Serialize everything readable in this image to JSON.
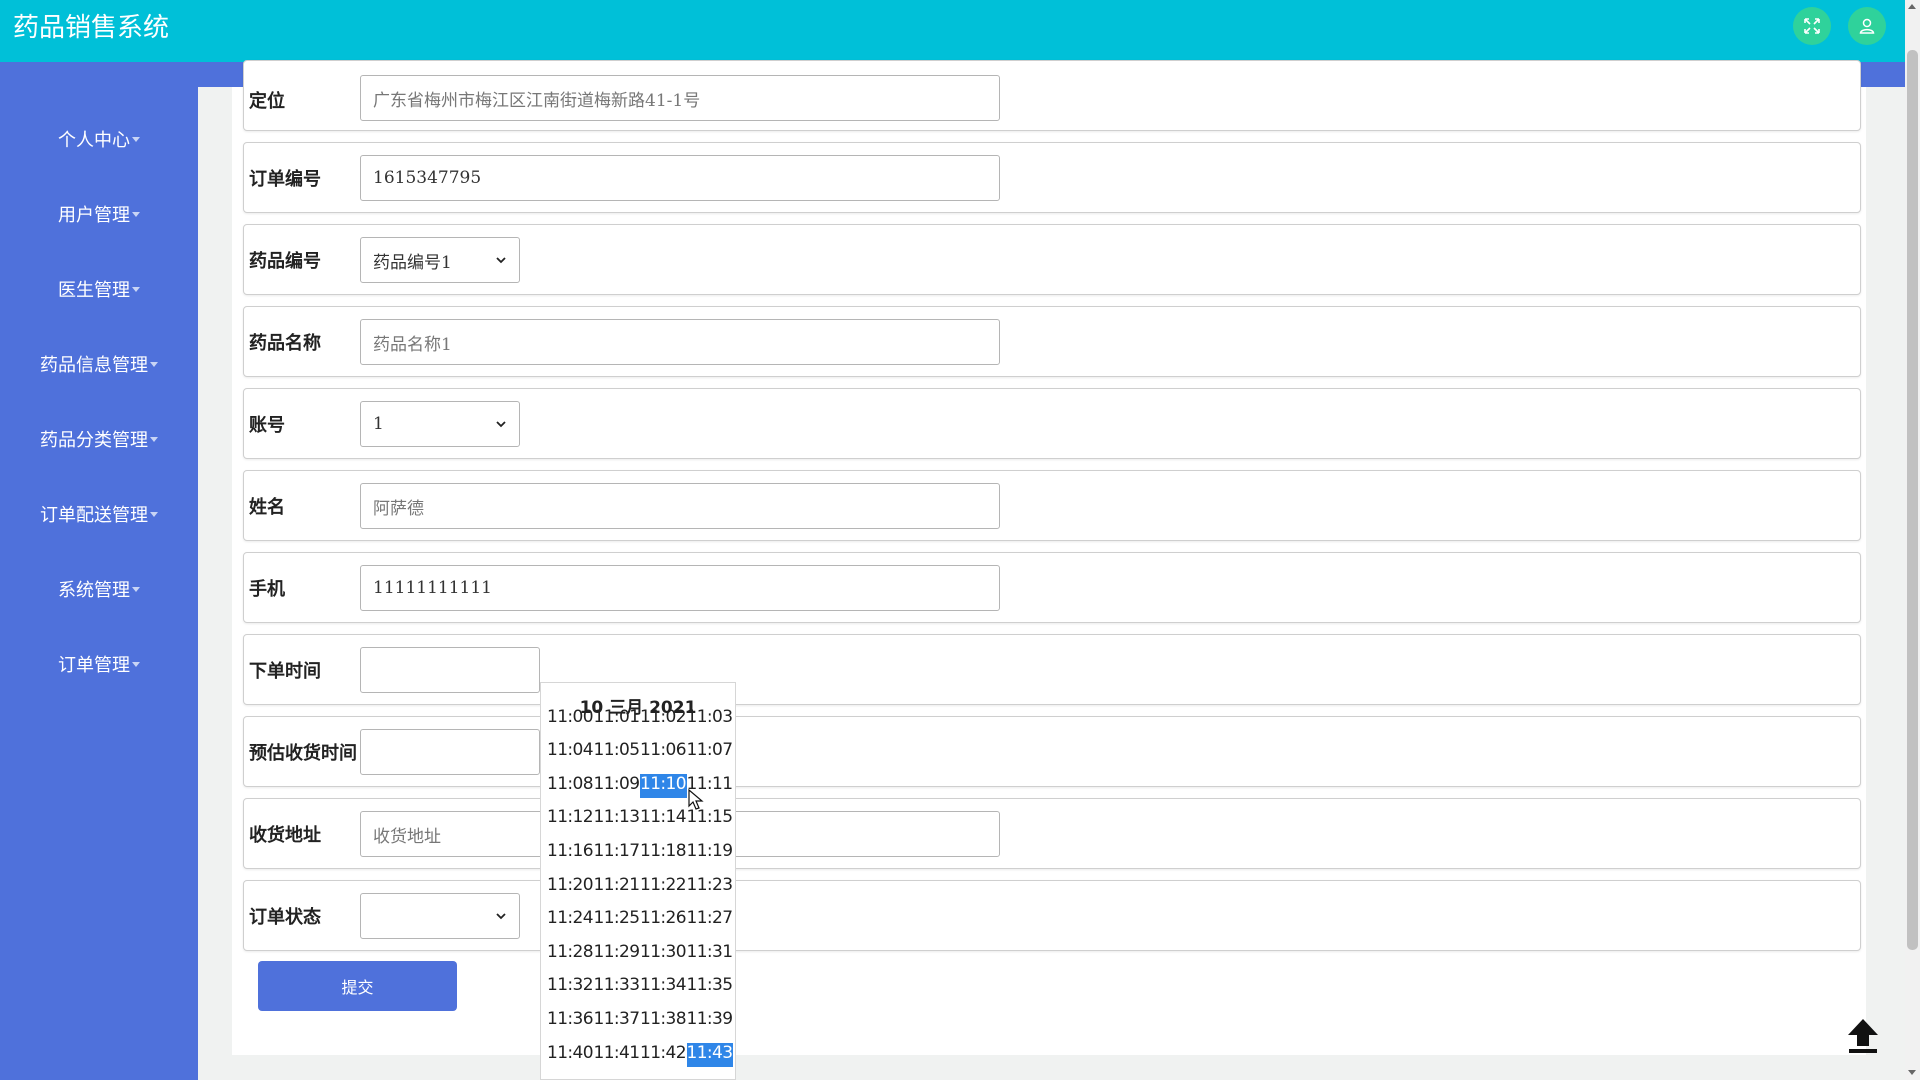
{
  "app": {
    "title": "药品销售系统"
  },
  "header_icons": [
    "fullscreen-icon",
    "user-icon"
  ],
  "sidebar": {
    "items": [
      {
        "label": "个人中心"
      },
      {
        "label": "用户管理"
      },
      {
        "label": "医生管理"
      },
      {
        "label": "药品信息管理"
      },
      {
        "label": "药品分类管理"
      },
      {
        "label": "订单配送管理"
      },
      {
        "label": "系统管理"
      },
      {
        "label": "订单管理"
      }
    ]
  },
  "form": {
    "location": {
      "label": "定位",
      "value": "广东省梅州市梅江区江南街道梅新路41-1号"
    },
    "order_no": {
      "label": "订单编号",
      "value": "1615347795"
    },
    "drug_no": {
      "label": "药品编号",
      "value": "药品编号1"
    },
    "drug_name": {
      "label": "药品名称",
      "value": "药品名称1"
    },
    "account": {
      "label": "账号",
      "value": "1"
    },
    "name": {
      "label": "姓名",
      "value": "阿萨德"
    },
    "phone": {
      "label": "手机",
      "value": "11111111111"
    },
    "order_time": {
      "label": "下单时间",
      "value": ""
    },
    "eta": {
      "label": "预估收货时间",
      "value": ""
    },
    "address": {
      "label": "收货地址",
      "placeholder": "收货地址"
    },
    "status": {
      "label": "订单状态",
      "value": ""
    },
    "submit_label": "提交"
  },
  "datetime_picker": {
    "title": "10 三月 2021",
    "rows": [
      [
        "11:00",
        "11:01",
        "11:02",
        "11:03"
      ],
      [
        "11:04",
        "11:05",
        "11:06",
        "11:07"
      ],
      [
        "11:08",
        "11:09",
        "11:10",
        "11:11"
      ],
      [
        "11:12",
        "11:13",
        "11:14",
        "11:15"
      ],
      [
        "11:16",
        "11:17",
        "11:18",
        "11:19"
      ],
      [
        "11:20",
        "11:21",
        "11:22",
        "11:23"
      ],
      [
        "11:24",
        "11:25",
        "11:26",
        "11:27"
      ],
      [
        "11:28",
        "11:29",
        "11:30",
        "11:31"
      ],
      [
        "11:32",
        "11:33",
        "11:34",
        "11:35"
      ],
      [
        "11:36",
        "11:37",
        "11:38",
        "11:39"
      ],
      [
        "11:40",
        "11:41",
        "11:42",
        "11:43"
      ]
    ],
    "highlighted": [
      "11:10",
      "11:43"
    ]
  },
  "colors": {
    "header": "#00c0d8",
    "sidebar": "#4f71db",
    "highlight": "#2f86e8",
    "icon_bg": "#2fd29b"
  }
}
